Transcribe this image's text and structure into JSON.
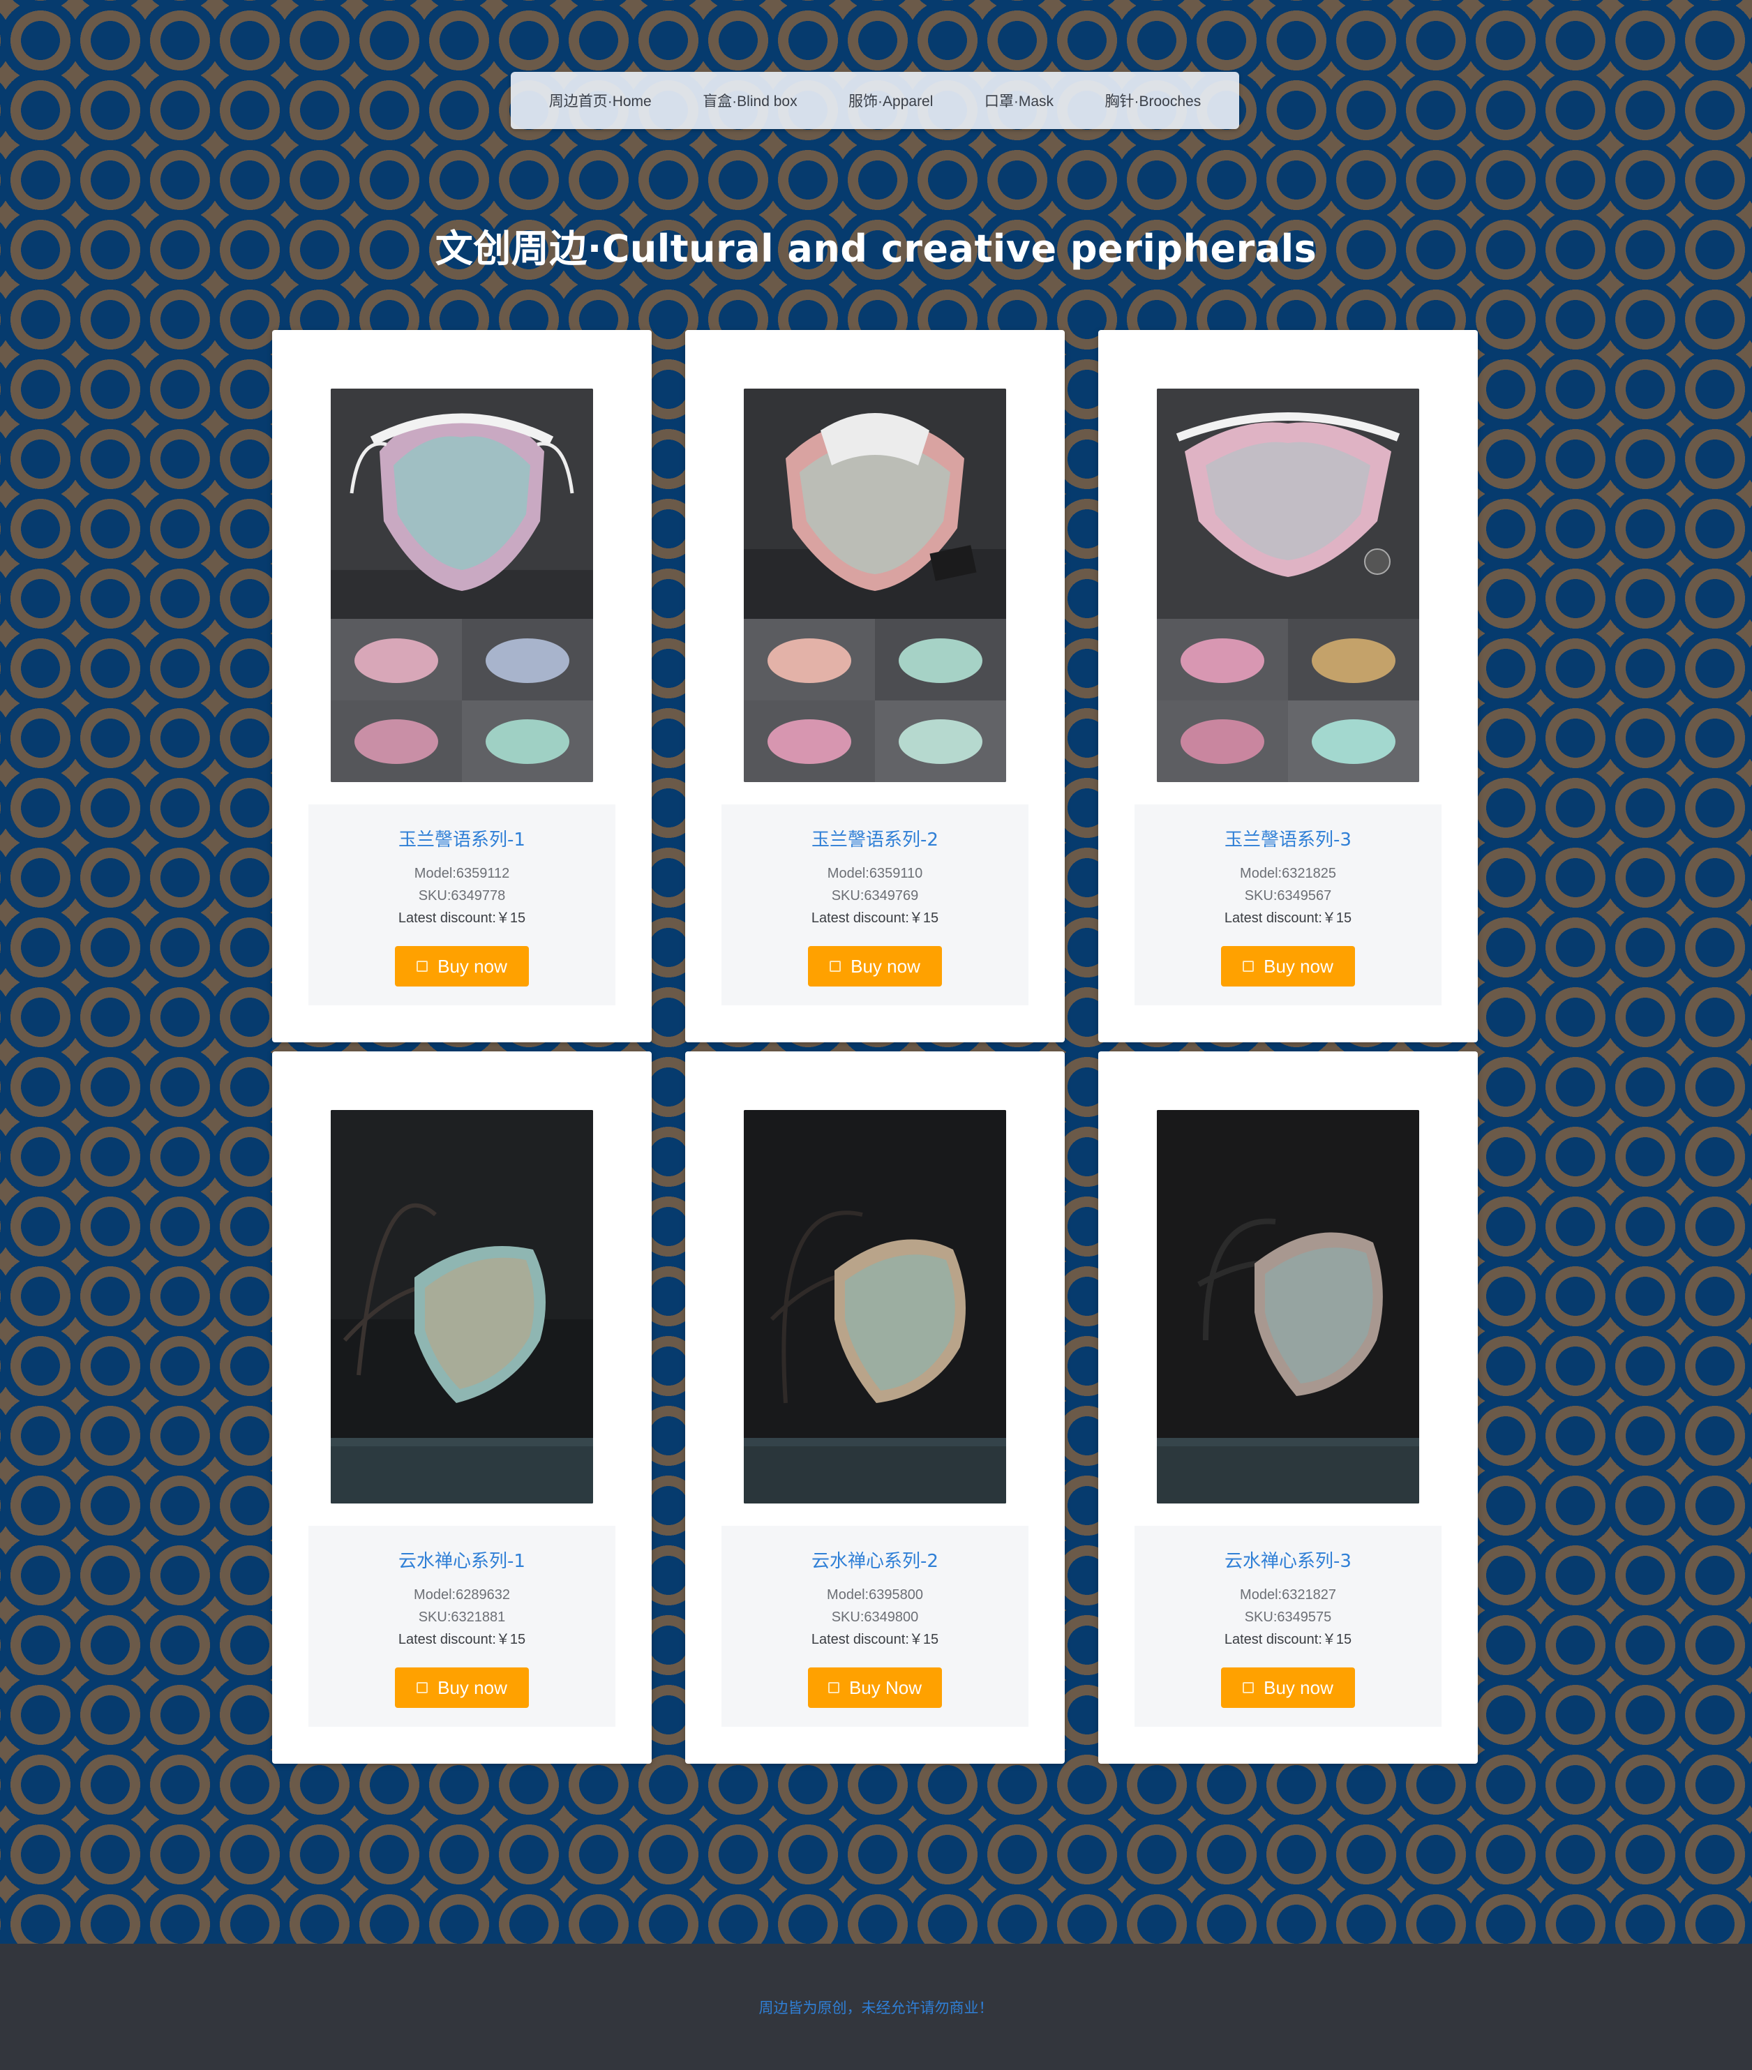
{
  "nav": {
    "items": [
      {
        "label": "周边首页·Home"
      },
      {
        "label": "盲盒·Blind box"
      },
      {
        "label": "服饰·Apparel"
      },
      {
        "label": "口罩·Mask"
      },
      {
        "label": "胸针·Brooches"
      }
    ]
  },
  "page": {
    "title": "文创周边·Cultural and creative peripherals"
  },
  "products": [
    {
      "name": "玉兰謦语系列-1",
      "model": "Model:6359112",
      "sku": "SKU:6349778",
      "discount": "Latest discount:￥15",
      "button": "Buy now",
      "image_icon": "floral-mask-collage"
    },
    {
      "name": "玉兰謦语系列-2",
      "model": "Model:6359110",
      "sku": "SKU:6349769",
      "discount": "Latest discount:￥15",
      "button": "Buy now",
      "image_icon": "floral-mask-collage"
    },
    {
      "name": "玉兰謦语系列-3",
      "model": "Model:6321825",
      "sku": "SKU:6349567",
      "discount": "Latest discount:￥15",
      "button": "Buy now",
      "image_icon": "floral-mask-collage"
    },
    {
      "name": "云水禅心系列-1",
      "model": "Model:6289632",
      "sku": "SKU:6321881",
      "discount": "Latest discount:￥15",
      "button": "Buy now",
      "image_icon": "floating-mask"
    },
    {
      "name": "云水禅心系列-2",
      "model": "Model:6395800",
      "sku": "SKU:6349800",
      "discount": "Latest discount:￥15",
      "button": "Buy Now",
      "image_icon": "floating-mask"
    },
    {
      "name": "云水禅心系列-3",
      "model": "Model:6321827",
      "sku": "SKU:6349575",
      "discount": "Latest discount:￥15",
      "button": "Buy now",
      "image_icon": "floating-mask"
    }
  ],
  "footer": {
    "text": "周边皆为原创，未经允许请勿商业！"
  },
  "colors": {
    "background": "#063b6e",
    "ring": "#6b5a49",
    "accent_button": "#ffa100",
    "link_blue": "#2f7fd6",
    "footer_bg": "#33363d"
  }
}
